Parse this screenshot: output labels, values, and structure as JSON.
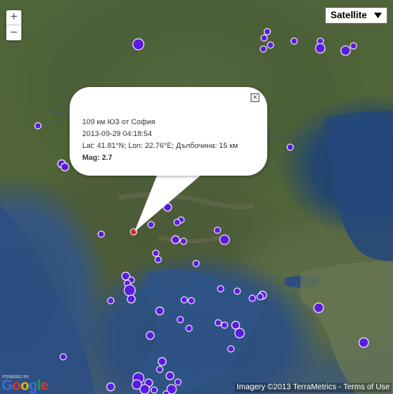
{
  "map": {
    "zoom_in": "+",
    "zoom_out": "−",
    "map_type": "Satellite"
  },
  "infowindow": {
    "distance": "109 км ЮЗ от София",
    "datetime": "2013-09-29 04:18:54",
    "coords": "Lat: 41.81°N; Lon: 22.76°E; Дълбочина: 15 км",
    "mag_label": "Mag:",
    "mag_value": "2.7",
    "close_glyph": "×"
  },
  "colors": {
    "marker_fill": "#5b1be0",
    "marker_stroke": "#ffffff",
    "selected_marker": "#d91f1f"
  },
  "icons": [
    "zoom-in-icon",
    "zoom-out-icon",
    "dropdown-arrow-icon",
    "close-icon"
  ],
  "footer": {
    "logo_prefix": "POWERED BY",
    "logo_letters": [
      "G",
      "o",
      "o",
      "g",
      "l",
      "e"
    ],
    "logo_colors": [
      "#3b6fd8",
      "#d8382c",
      "#f2b90e",
      "#3b6fd8",
      "#2f9c3f",
      "#d8382c"
    ],
    "imagery": "Imagery ©2013 TerraMetrics",
    "separator": " - ",
    "terms": "Terms of Use"
  }
}
